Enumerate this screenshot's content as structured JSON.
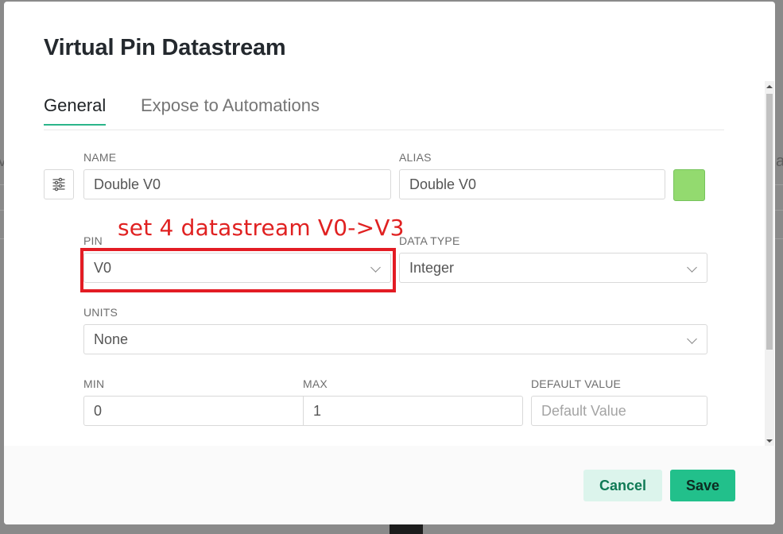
{
  "background": {
    "left_text": "V",
    "right_text": "as"
  },
  "modal": {
    "title": "Virtual Pin Datastream",
    "tabs": [
      {
        "label": "General",
        "active": true
      },
      {
        "label": "Expose to Automations",
        "active": false
      }
    ],
    "fields": {
      "name": {
        "label": "NAME",
        "value": "Double V0"
      },
      "alias": {
        "label": "ALIAS",
        "value": "Double V0"
      },
      "pin": {
        "label": "PIN",
        "value": "V0"
      },
      "data_type": {
        "label": "DATA TYPE",
        "value": "Integer"
      },
      "units": {
        "label": "UNITS",
        "value": "None"
      },
      "min": {
        "label": "MIN",
        "value": "0"
      },
      "max": {
        "label": "MAX",
        "value": "1"
      },
      "default_value": {
        "label": "DEFAULT VALUE",
        "placeholder": "Default Value"
      }
    },
    "color_swatch": "#93da6f",
    "annotation_text": "set 4 datastream V0->V3",
    "buttons": {
      "cancel": "Cancel",
      "save": "Save"
    },
    "icons": {
      "settings": "sliders-icon",
      "dropdown": "chevron-down-icon"
    },
    "colors": {
      "accent": "#22c08b",
      "annotation": "#e31c24"
    }
  }
}
